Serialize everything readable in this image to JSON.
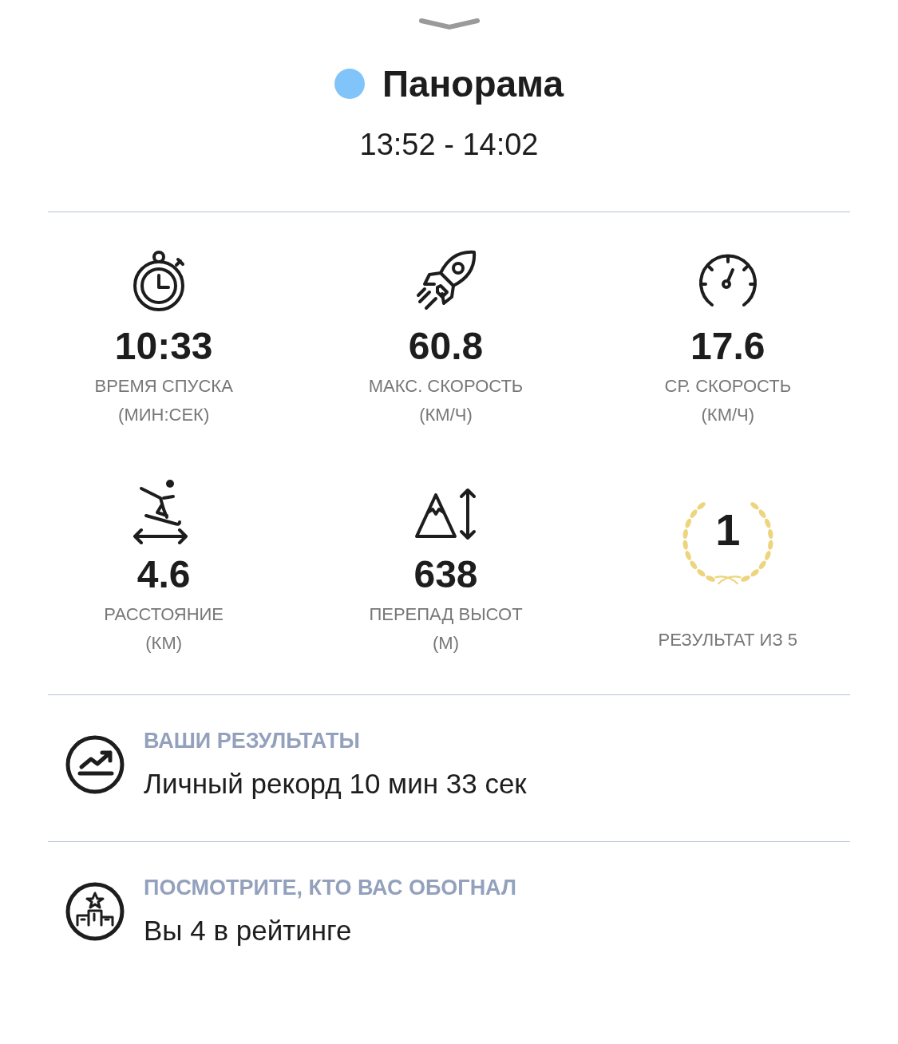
{
  "header": {
    "title": "Панорама",
    "time": "13:52 - 14:02"
  },
  "stats": [
    {
      "kind": "stopwatch",
      "value": "10:33",
      "label": "ВРЕМЯ СПУСКА",
      "unit": "(МИН:СЕК)"
    },
    {
      "kind": "rocket",
      "value": "60.8",
      "label": "МАКС. СКОРОСТЬ",
      "unit": "(КМ/Ч)"
    },
    {
      "kind": "speedometer",
      "value": "17.6",
      "label": "СР. СКОРОСТЬ",
      "unit": "(КМ/Ч)"
    },
    {
      "kind": "skier",
      "value": "4.6",
      "label": "РАССТОЯНИЕ",
      "unit": "(КМ)"
    },
    {
      "kind": "mountain",
      "value": "638",
      "label": "ПЕРЕПАД ВЫСОТ",
      "unit": "(М)"
    },
    {
      "kind": "rank",
      "value": "1",
      "label": "РЕЗУЛЬТАТ ИЗ 5"
    }
  ],
  "sections": [
    {
      "kind": "chart",
      "title": "ВАШИ РЕЗУЛЬТАТЫ",
      "text": "Личный рекорд 10 мин 33 сек"
    },
    {
      "kind": "podium",
      "title": "ПОСМОТРИТЕ, КТО ВАС ОБОГНАЛ",
      "text": "Вы 4 в рейтинге"
    }
  ]
}
